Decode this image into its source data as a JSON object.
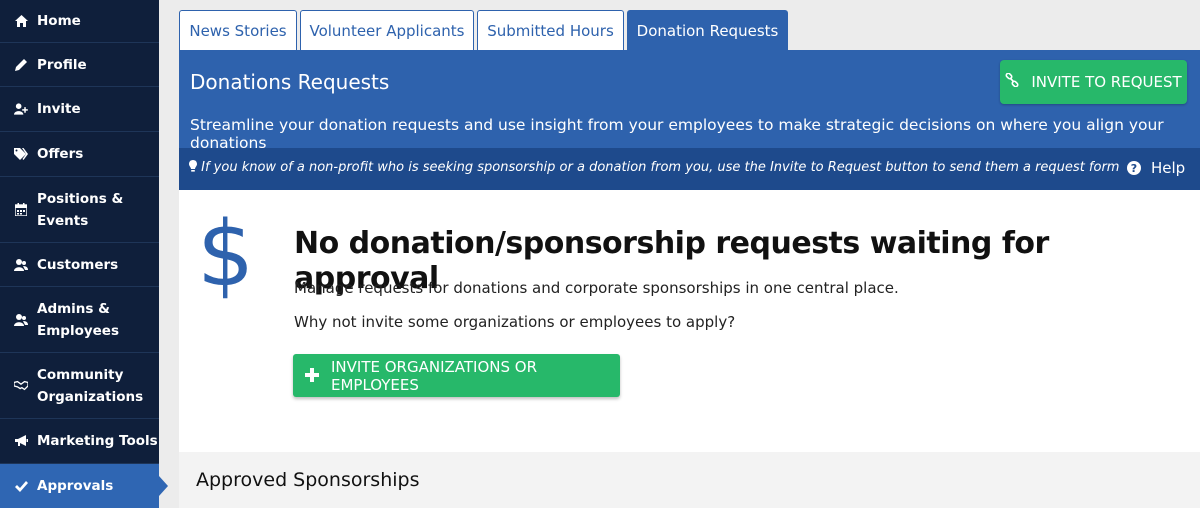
{
  "sidebar": {
    "items": [
      {
        "label": "Home",
        "icon": "home-icon"
      },
      {
        "label": "Profile",
        "icon": "pencil-icon"
      },
      {
        "label": "Invite",
        "icon": "user-plus-icon"
      },
      {
        "label": "Offers",
        "icon": "tags-icon"
      },
      {
        "label": "Positions &\nEvents",
        "icon": "calendar-icon"
      },
      {
        "label": "Customers",
        "icon": "users-icon"
      },
      {
        "label": "Admins &\nEmployees",
        "icon": "user-group-icon"
      },
      {
        "label": "Community\nOrganizations",
        "icon": "handshake-icon"
      },
      {
        "label": "Marketing Tools",
        "icon": "megaphone-icon"
      },
      {
        "label": "Approvals",
        "icon": "check-icon",
        "active": true
      }
    ]
  },
  "tabs": [
    {
      "label": "News Stories"
    },
    {
      "label": "Volunteer Applicants"
    },
    {
      "label": "Submitted Hours"
    },
    {
      "label": "Donation Requests",
      "active": true
    }
  ],
  "banner": {
    "title": "Donations Requests",
    "description": "Streamline your donation requests and use insight from your employees to make strategic decisions on where you align your donations",
    "invite_button": "INVITE TO REQUEST",
    "tip": "If you know of a non-profit who is seeking sponsorship or a donation from you, use the Invite to Request button to send them a request form",
    "help": "Help"
  },
  "empty_state": {
    "symbol": "$",
    "title": "No donation/sponsorship requests waiting for approval",
    "line1": "Manage requests for donations and corporate sponsorships in one central place.",
    "line2": "Why not invite some organizations or employees to apply?",
    "button": "INVITE ORGANIZATIONS OR EMPLOYEES"
  },
  "approved": {
    "title": "Approved Sponsorships"
  },
  "colors": {
    "sidebar_bg": "#0f1f3b",
    "accent_blue": "#2e62ad",
    "green": "#27b86a"
  }
}
